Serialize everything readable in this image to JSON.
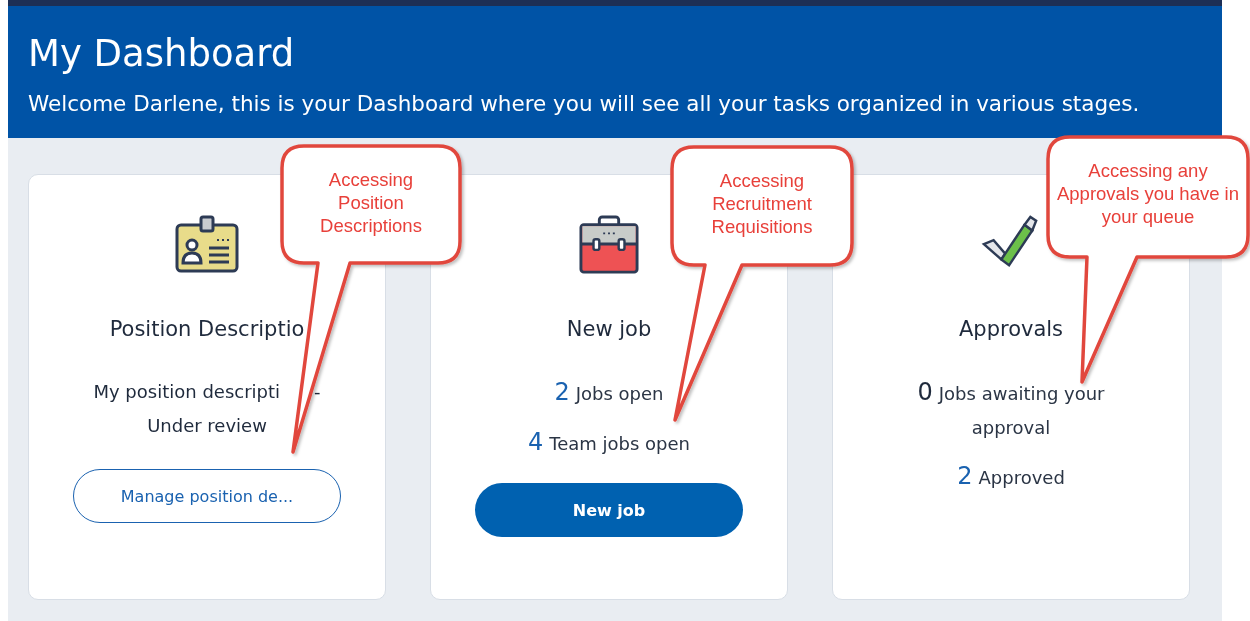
{
  "header": {
    "title": "My Dashboard",
    "welcome": "Welcome Darlene, this is your Dashboard where you will see all your tasks organized in various stages."
  },
  "cards": [
    {
      "title": "Position Descriptio",
      "stats": [
        {
          "kind": "text",
          "parts": [
            "My position descripti",
            "-",
            "Under review"
          ]
        }
      ],
      "button": {
        "label": "Manage position de..."
      }
    },
    {
      "title": "New job",
      "stats": [
        {
          "kind": "count",
          "count": "2",
          "label": "Jobs open",
          "emphasis": true
        },
        {
          "kind": "count",
          "count": "4",
          "label": "Team jobs open",
          "emphasis": true
        }
      ],
      "button": {
        "label": "New job"
      }
    },
    {
      "title": "Approvals",
      "stats": [
        {
          "kind": "count",
          "count": "0",
          "label": "Jobs awaiting your approval",
          "emphasis": false
        },
        {
          "kind": "count",
          "count": "2",
          "label": "Approved",
          "emphasis": true
        }
      ]
    }
  ],
  "callouts": [
    {
      "text": "Accessing Position Descriptions"
    },
    {
      "text": "Accessing Recruitment Requisitions"
    },
    {
      "text": "Accessing any Approvals you have in your queue"
    }
  ]
}
